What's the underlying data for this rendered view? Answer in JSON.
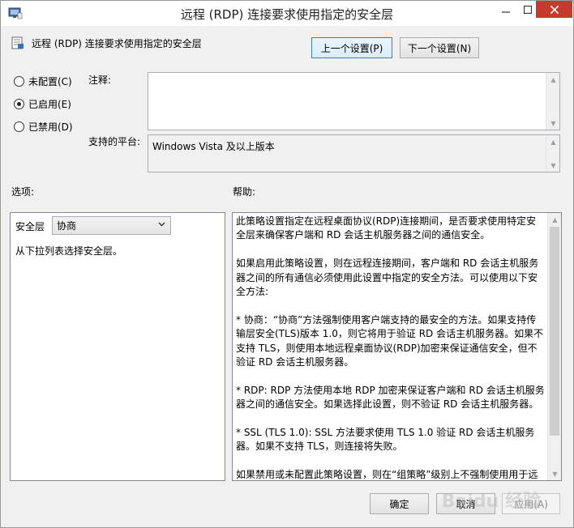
{
  "window": {
    "title": "远程 (RDP) 连接要求使用指定的安全层"
  },
  "header": {
    "policy_name": "远程 (RDP) 连接要求使用指定的安全层",
    "prev_button": "上一个设置(P)",
    "next_button": "下一个设置(N)"
  },
  "state": {
    "options": [
      {
        "label": "未配置(C)",
        "checked": false
      },
      {
        "label": "已启用(E)",
        "checked": true
      },
      {
        "label": "已禁用(D)",
        "checked": false
      }
    ]
  },
  "fields": {
    "comment_label": "注释:",
    "comment_value": "",
    "platform_label": "支持的平台:",
    "platform_value": "Windows Vista 及以上版本"
  },
  "sections": {
    "options_label": "选项:",
    "help_label": "帮助:"
  },
  "options_panel": {
    "field_label": "安全层",
    "selected_value": "协商",
    "description": "从下拉列表选择安全层。"
  },
  "help": {
    "paragraphs": [
      "此策略设置指定在远程桌面协议(RDP)连接期间，是否要求使用特定安全层来确保客户端和 RD 会话主机服务器之间的通信安全。",
      "如果启用此策略设置，则在远程连接期间，客户端和 RD 会话主机服务器之间的所有通信必须使用此设置中指定的安全方法。可以使用以下安全方法:",
      "* 协商：“协商”方法强制使用客户端支持的最安全的方法。如果支持传输层安全(TLS)版本 1.0，则它将用于验证 RD 会话主机服务器。如果不支持 TLS，则使用本地远程桌面协议(RDP)加密来保证通信安全，但不验证 RD 会话主机服务器。",
      "* RDP: RDP 方法使用本地 RDP 加密来保证客户端和 RD 会话主机服务器之间的通信安全。如果选择此设置，则不验证 RD 会话主机服务器。",
      "* SSL (TLS 1.0): SSL 方法要求使用 TLS 1.0 验证 RD 会话主机服务器。如果不支持 TLS，则连接将失败。",
      "如果禁用或未配置此策略设置，则在“组策略”级别上不强制使用用于远"
    ]
  },
  "footer": {
    "ok": "确定",
    "cancel": "取消",
    "apply": "应用(A)"
  },
  "watermark": "Baidu 经验"
}
